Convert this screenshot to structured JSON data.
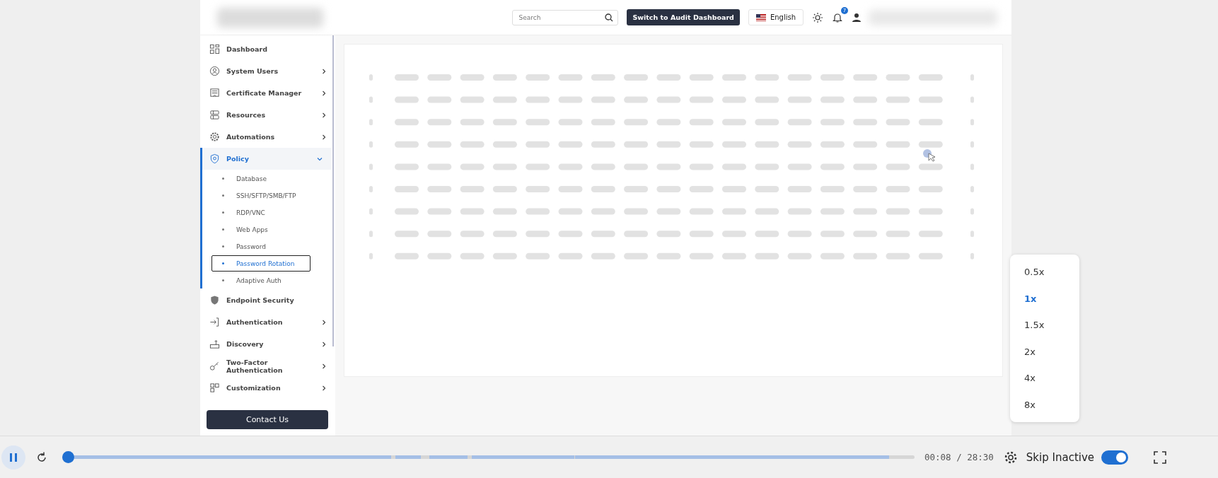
{
  "header": {
    "search": {
      "placeholder": "Search"
    },
    "audit_button": "Switch to Audit Dashboard",
    "language": "English",
    "notification_count": "7"
  },
  "sidebar": {
    "items": [
      {
        "label": "Dashboard",
        "selected": false
      },
      {
        "label": "System Users",
        "selected": false,
        "expanded": false
      },
      {
        "label": "Certificate Manager",
        "selected": false,
        "expanded": false
      },
      {
        "label": "Resources",
        "selected": false,
        "expanded": false
      },
      {
        "label": "Automations",
        "selected": false,
        "expanded": false
      },
      {
        "label": "Policy",
        "selected": true,
        "expanded": true,
        "children": [
          {
            "label": "Database",
            "selected": false
          },
          {
            "label": "SSH/SFTP/SMB/FTP",
            "selected": false
          },
          {
            "label": "RDP/VNC",
            "selected": false
          },
          {
            "label": "Web Apps",
            "selected": false
          },
          {
            "label": "Password",
            "selected": false
          },
          {
            "label": "Password Rotation",
            "selected": true
          },
          {
            "label": "Adaptive Auth",
            "selected": false
          }
        ]
      },
      {
        "label": "Endpoint Security",
        "selected": false
      },
      {
        "label": "Authentication",
        "selected": false,
        "expanded": false
      },
      {
        "label": "Discovery",
        "selected": false,
        "expanded": false
      },
      {
        "label": "Two-Factor Authentication",
        "selected": false,
        "expanded": false
      },
      {
        "label": "Customization",
        "selected": false,
        "expanded": false
      }
    ],
    "contact_button": "Contact Us"
  },
  "content": {
    "kind": "loading"
  },
  "speed_menu": [
    {
      "label": "0.5x",
      "selected": false
    },
    {
      "label": "1x",
      "selected": true
    },
    {
      "label": "1.5x",
      "selected": false
    },
    {
      "label": "2x",
      "selected": false
    },
    {
      "label": "4x",
      "selected": false
    },
    {
      "label": "8x",
      "selected": false
    }
  ],
  "player": {
    "playing": true,
    "level": 0.005,
    "time": "00:08 / 28:30",
    "skip_inactive": {
      "label": "Skip Inactive",
      "on": true
    }
  }
}
